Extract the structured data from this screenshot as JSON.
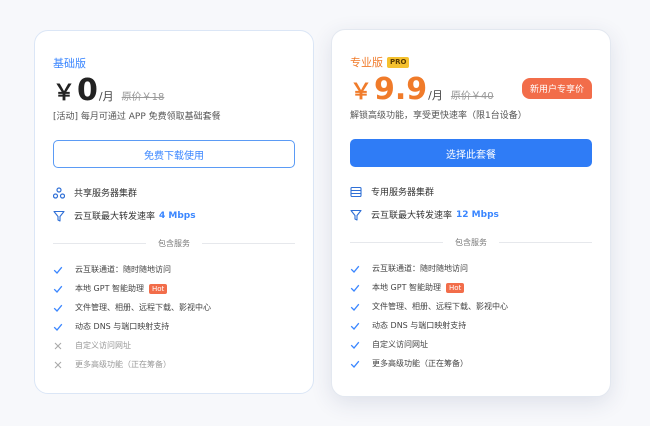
{
  "basic": {
    "plan_name": "基础版",
    "price": {
      "currency": "￥",
      "amount": "0",
      "unit": "/月",
      "original": "原价￥18"
    },
    "description": "[活动] 每月可通过 APP 免费领取基础套餐",
    "button_label": "免费下载使用",
    "features": [
      {
        "icon": "shared-cluster-icon",
        "label": "共享服务器集群"
      },
      {
        "icon": "funnel-speed-icon",
        "label": "云互联最大转发速率",
        "highlight": "4 Mbps"
      }
    ],
    "services_title": "包含服务",
    "services": [
      {
        "label": "云互联通道：随时随地访问",
        "included": true
      },
      {
        "label": "本地 GPT 智能助理",
        "included": true,
        "badge": "Hot"
      },
      {
        "label": "文件管理、相册、远程下载、影视中心",
        "included": true
      },
      {
        "label": "动态 DNS 与端口映射支持",
        "included": true
      },
      {
        "label": "自定义访问网址",
        "included": false
      },
      {
        "label": "更多高级功能（正在筹备）",
        "included": false
      }
    ]
  },
  "pro": {
    "plan_name": "专业版",
    "plan_badge": "PRO",
    "price": {
      "currency": "￥",
      "amount": "9.9",
      "unit": "/月",
      "original": "原价￥40"
    },
    "promo_badge": "新用户专享价",
    "description": "解锁高级功能，享受更快速率（限1台设备）",
    "button_label": "选择此套餐",
    "features": [
      {
        "icon": "dedicated-server-icon",
        "label": "专用服务器集群"
      },
      {
        "icon": "funnel-speed-icon",
        "label": "云互联最大转发速率",
        "highlight": "12 Mbps"
      }
    ],
    "services_title": "包含服务",
    "services": [
      {
        "label": "云互联通道：随时随地访问",
        "included": true
      },
      {
        "label": "本地 GPT 智能助理",
        "included": true,
        "badge": "Hot"
      },
      {
        "label": "文件管理、相册、远程下载、影视中心",
        "included": true
      },
      {
        "label": "动态 DNS 与端口映射支持",
        "included": true
      },
      {
        "label": "自定义访问网址",
        "included": true
      },
      {
        "label": "更多高级功能（正在筹备）",
        "included": true
      }
    ]
  },
  "colors": {
    "accent": "#3a86ff",
    "pro_accent": "#f07b2a",
    "hot": "#f26d4a",
    "primary_button": "#2f7cf6"
  }
}
